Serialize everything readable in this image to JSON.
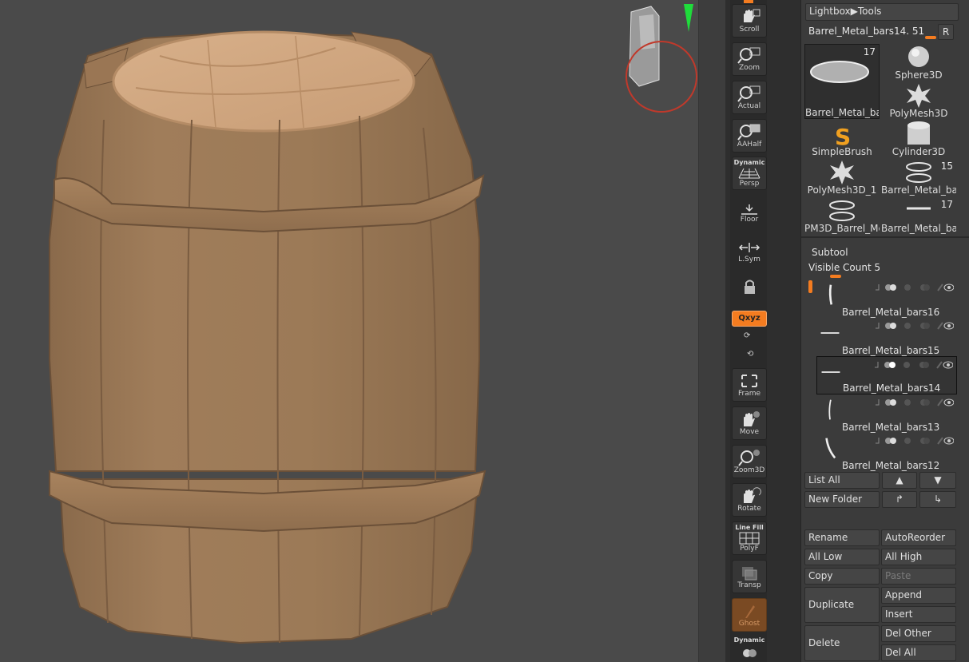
{
  "shelf": {
    "scroll": "Scroll",
    "zoom": "Zoom",
    "actual": "Actual",
    "aahalf": "AAHalf",
    "persp_top": "Dynamic",
    "persp": "Persp",
    "floor": "Floor",
    "lsym": "L.Sym",
    "xyz": "Qxyz",
    "frame": "Frame",
    "move": "Move",
    "zoom3d": "Zoom3D",
    "rotate": "Rotate",
    "polyf_top": "Line Fill",
    "polyf": "PolyF",
    "transp": "Transp",
    "ghost": "Ghost",
    "solo_top": "Dynamic"
  },
  "tool": {
    "lightbox_label": "Lightbox▶Tools",
    "current_tool": "Barrel_Metal_bars14. 51",
    "r_button": "R",
    "items": [
      {
        "label": "Barrel_Metal_ba",
        "count": "17",
        "icon": "ring-flat-icon"
      },
      {
        "label": "Sphere3D",
        "count": "",
        "icon": "sphere-icon"
      },
      {
        "label": "PolyMesh3D",
        "count": "",
        "icon": "star-icon"
      },
      {
        "label": "SimpleBrush",
        "count": "",
        "icon": "simplebrush-icon"
      },
      {
        "label": "Cylinder3D",
        "count": "",
        "icon": "cylinder-icon"
      },
      {
        "label": "PolyMesh3D_1",
        "count": "",
        "icon": "star-icon"
      },
      {
        "label": "Barrel_Metal_bar",
        "count": "15",
        "icon": "rings-icon"
      },
      {
        "label": "PM3D_Barrel_Me",
        "count": "",
        "icon": "rings-icon"
      },
      {
        "label": "Barrel_Metal_ba",
        "count": "17",
        "icon": "bar-icon"
      }
    ]
  },
  "subtool": {
    "title": "Subtool",
    "visible_count_label": "Visible Count",
    "visible_count": "5",
    "items": [
      {
        "name": "Barrel_Metal_bars16",
        "active": false
      },
      {
        "name": "Barrel_Metal_bars15",
        "active": false
      },
      {
        "name": "Barrel_Metal_bars14",
        "active": true
      },
      {
        "name": "Barrel_Metal_bars13",
        "active": false
      },
      {
        "name": "Barrel_Metal_bars12",
        "active": false
      }
    ],
    "list_all": "List All",
    "new_folder": "New Folder",
    "rename": "Rename",
    "autoreorder": "AutoReorder",
    "all_low": "All Low",
    "all_high": "All High",
    "copy": "Copy",
    "paste": "Paste",
    "duplicate": "Duplicate",
    "append": "Append",
    "insert": "Insert",
    "delete": "Delete",
    "del_other": "Del Other",
    "del_all": "Del All"
  },
  "colors": {
    "accent": "#f47c20",
    "wood": "#a07d5a",
    "viewport_bg": "#4a4a4a"
  }
}
